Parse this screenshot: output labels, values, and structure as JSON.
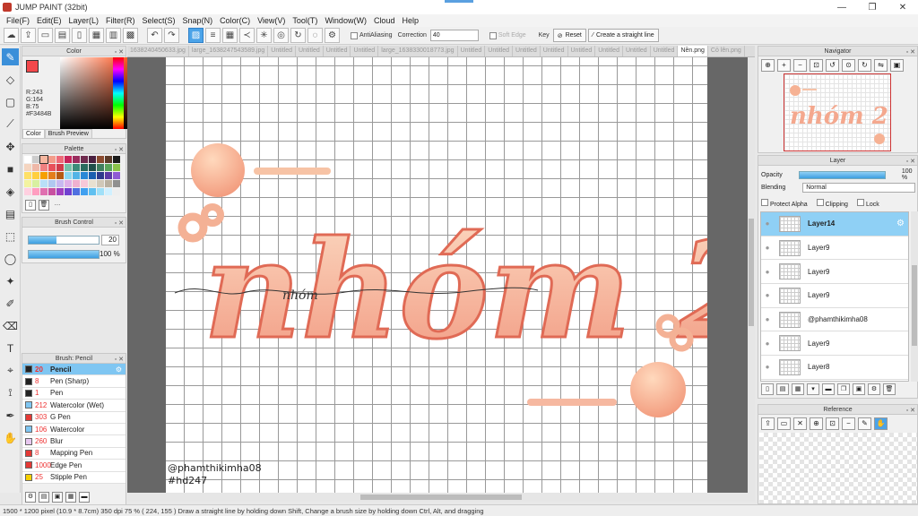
{
  "window": {
    "title": "JUMP PAINT (32bit)",
    "minimize": "—",
    "maximize": "❐",
    "close": "✕"
  },
  "menu": [
    "File(F)",
    "Edit(E)",
    "Layer(L)",
    "Filter(R)",
    "Select(S)",
    "Snap(N)",
    "Color(C)",
    "View(V)",
    "Tool(T)",
    "Window(W)",
    "Cloud",
    "Help"
  ],
  "toolbar": {
    "antialiasing": "AntiAliasing",
    "correction_label": "Correction",
    "correction_value": "40",
    "soft_edge": "Soft Edge",
    "key": "Key",
    "reset": "Reset",
    "straight_line": "Create a straight line"
  },
  "color_panel": {
    "title": "Color",
    "r": "R:243",
    "g": "G:164",
    "b": "B:75",
    "hex": "#F3484B",
    "tab_color": "Color",
    "tab_preview": "Brush Preview",
    "fg": "#F3484B"
  },
  "palette": {
    "title": "Palette",
    "colors": [
      "#ffffff",
      "#cccccc",
      "#f6b7a0",
      "#f39c8a",
      "#ee6b79",
      "#c7245a",
      "#9a2d5e",
      "#6f2b4e",
      "#4a2040",
      "#8c4b2f",
      "#5b3a29",
      "#1b1b1b",
      "#f5d5c0",
      "#efb8a8",
      "#f08080",
      "#e8505b",
      "#d13b4b",
      "#76c0a8",
      "#3c8c7a",
      "#2a6b5e",
      "#1f4f4a",
      "#3f7f5f",
      "#5aa55a",
      "#8bc34a",
      "#ffe066",
      "#ffcf40",
      "#f6a000",
      "#e47e1b",
      "#b55a12",
      "#8cd8f0",
      "#52b4e6",
      "#2a88d6",
      "#1a5fb0",
      "#2d3a8c",
      "#5b3aa5",
      "#8e5bd4",
      "#f3f3a0",
      "#d8f0a0",
      "#b8e0f8",
      "#b0c8f0",
      "#c8b8f0",
      "#e0b0e8",
      "#f0b0d0",
      "#f8c8d8",
      "#e8e0d0",
      "#d0c8b8",
      "#b8b0a0",
      "#909090",
      "#ffd0e0",
      "#ff9ec0",
      "#e070b0",
      "#c850a0",
      "#a040c0",
      "#7040d0",
      "#5070e0",
      "#40a0f0",
      "#60c0f0",
      "#a0e0f8",
      "#d0f0ff",
      "#eeeeee"
    ]
  },
  "brush_control": {
    "title": "Brush Control",
    "size": "20",
    "opacity": "100 %"
  },
  "brush_list": {
    "title": "Brush: Pencil",
    "items": [
      {
        "size": "20",
        "name": "Pencil",
        "color": "#222222"
      },
      {
        "size": "8",
        "name": "Pen (Sharp)",
        "color": "#222222"
      },
      {
        "size": "1",
        "name": "Pen",
        "color": "#222222"
      },
      {
        "size": "212",
        "name": "Watercolor (Wet)",
        "color": "#7fc6f2"
      },
      {
        "size": "303",
        "name": "G Pen",
        "color": "#e53935"
      },
      {
        "size": "106",
        "name": "Watercolor",
        "color": "#7fc6f2"
      },
      {
        "size": "260",
        "name": "Blur",
        "color": "#e8c8f0"
      },
      {
        "size": "8",
        "name": "Mapping Pen",
        "color": "#e53935"
      },
      {
        "size": "1000",
        "name": "Edge Pen",
        "color": "#e53935"
      },
      {
        "size": "25",
        "name": "Stipple Pen",
        "color": "#f6d000"
      }
    ]
  },
  "file_tabs": [
    "1638240450633.jpg",
    "large_1638247543589.jpg",
    "Untitled",
    "Untitled",
    "Untitled",
    "Untitled",
    "large_1638330018773.jpg",
    "Untitled",
    "Untitled",
    "Untitled",
    "Untitled",
    "Untitled",
    "Untitled",
    "Untitled",
    "Untitled",
    "Nền.png",
    "Cỏ lên.png"
  ],
  "canvas": {
    "artwork_text": "nhóm 2",
    "script_text": "nhóm",
    "credit": "@phamthikimha08",
    "hashtag": "#hd247"
  },
  "navigator": {
    "title": "Navigator",
    "thumb_text": "nhóm 2"
  },
  "layer_panel": {
    "title": "Layer",
    "opacity_label": "Opacity",
    "opacity_value": "100 %",
    "blending_label": "Blending",
    "blending_value": "Normal",
    "protect_alpha": "Protect Alpha",
    "clipping": "Clipping",
    "lock": "Lock",
    "layers": [
      "Layer14",
      "Layer9",
      "Layer9",
      "Layer9",
      "@phamthikimha08",
      "Layer9",
      "Layer8"
    ]
  },
  "reference_panel": {
    "title": "Reference"
  },
  "status": "1500 * 1200 pixel  (10.9 * 8.7cm)  350 dpi  75 %  ( 224, 155 )  Draw a straight line by holding down Shift, Change a brush size by holding down Ctrl, Alt, and dragging"
}
